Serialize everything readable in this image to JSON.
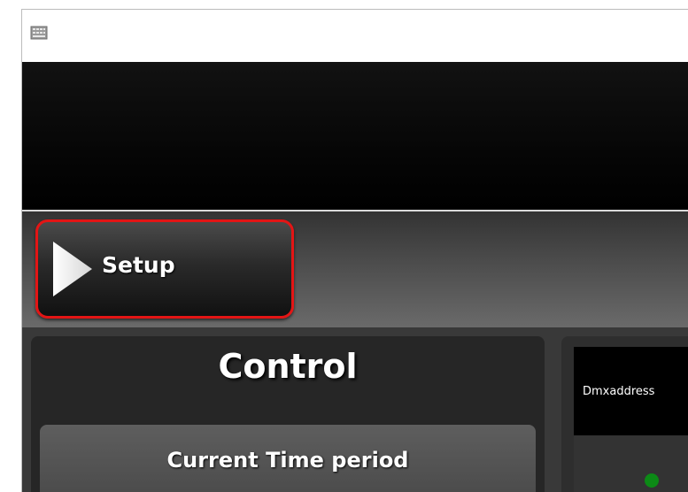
{
  "app": {
    "icon": "keyboard-app-icon"
  },
  "toolbar": {
    "setup_label": "Setup",
    "setup_icon": "play-triangle-icon",
    "highlight_color": "#e31515"
  },
  "control": {
    "title": "Control",
    "time_period_label": "Current Time period"
  },
  "dmx": {
    "header_label": "Dmxaddress",
    "status_color": "#0c8a16"
  }
}
